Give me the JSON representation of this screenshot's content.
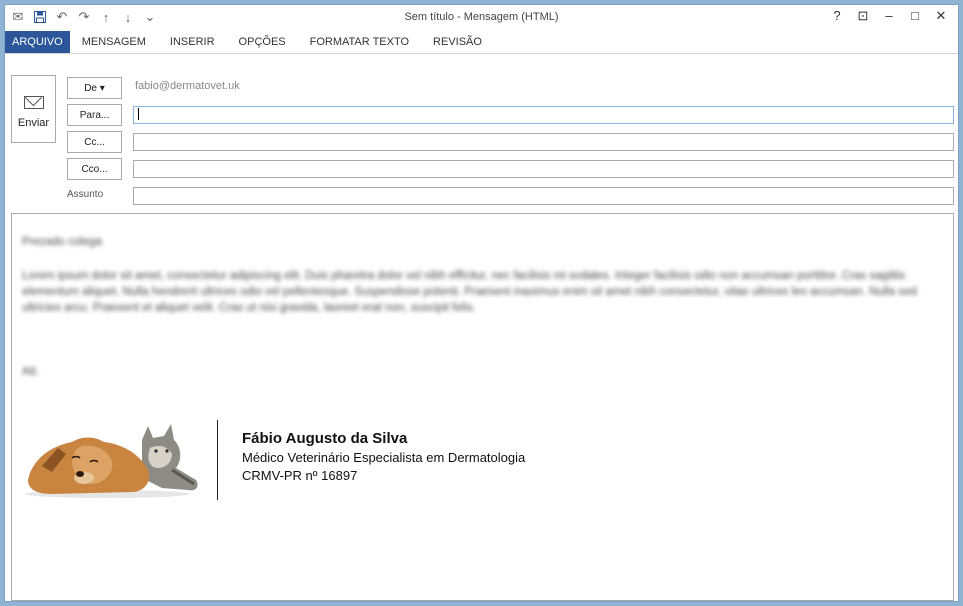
{
  "window": {
    "title": "Sem título - Mensagem (HTML)"
  },
  "window_controls": {
    "help": "?",
    "ribbon_toggle": "⊡",
    "minimize": "–",
    "maximize": "□",
    "close": "✕"
  },
  "ribbon": {
    "tabs": [
      "ARQUIVO",
      "MENSAGEM",
      "INSERIR",
      "OPÇÕES",
      "FORMATAR TEXTO",
      "REVISÃO"
    ]
  },
  "compose": {
    "send_label": "Enviar",
    "from_label": "De ▾",
    "from_value": "fabio@dermatovet.uk",
    "to_label": "Para...",
    "cc_label": "Cc...",
    "bcc_label": "Cco...",
    "subject_label": "Assunto"
  },
  "body": {
    "greeting": "Prezado colega",
    "paragraph": "Lorem ipsum dolor sit amet, consectetur adipiscing elit. Duis pharetra dolor vel nibh efficitur, nec facilisis mi sodales. Integer facilisis odio non accumsan porttitor. Cras sagittis elementum aliquet. Nulla hendrerit ultrices odio vel pellentesque. Suspendisse potenti. Praesent maximus enim sit amet nibh consectetur, vitae ultrices leo accumsan. Nulla sed ultricies arcu. Praesent et aliquet velit. Cras ut nisi gravida, laoreet erat non, suscipit felis.",
    "signoff": "Att."
  },
  "signature": {
    "name": "Fábio Augusto da Silva",
    "title": "Médico Veterinário Especialista em Dermatologia",
    "registration": "CRMV-PR nº 16897"
  },
  "colors": {
    "file_tab": "#2b579a",
    "window_frame": "#8fb3d3",
    "focus_border": "#8db5e2"
  }
}
